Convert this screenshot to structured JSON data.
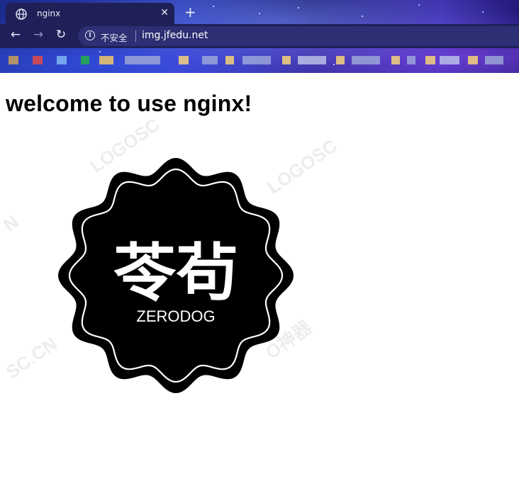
{
  "browser": {
    "tab": {
      "title": "nginx",
      "favicon": "globe-icon",
      "close_symbol": "✕"
    },
    "new_tab_symbol": "+",
    "nav": {
      "back": "←",
      "forward": "→",
      "reload": "↻"
    },
    "address": {
      "info_symbol": "i",
      "security_label": "不安全",
      "url": "img.jfedu.net"
    }
  },
  "page": {
    "heading": "welcome to use nginx!",
    "logo": {
      "chinese_text": "苓茍",
      "english_text": "ZERODOG",
      "description": "badge"
    },
    "watermarks": [
      "LOGOSC",
      "LOGOSC",
      "N",
      "SC.CN",
      "O神器"
    ]
  },
  "colors": {
    "chrome_dark": "#1e2057",
    "logo_black": "#000000",
    "page_bg": "#ffffff"
  }
}
